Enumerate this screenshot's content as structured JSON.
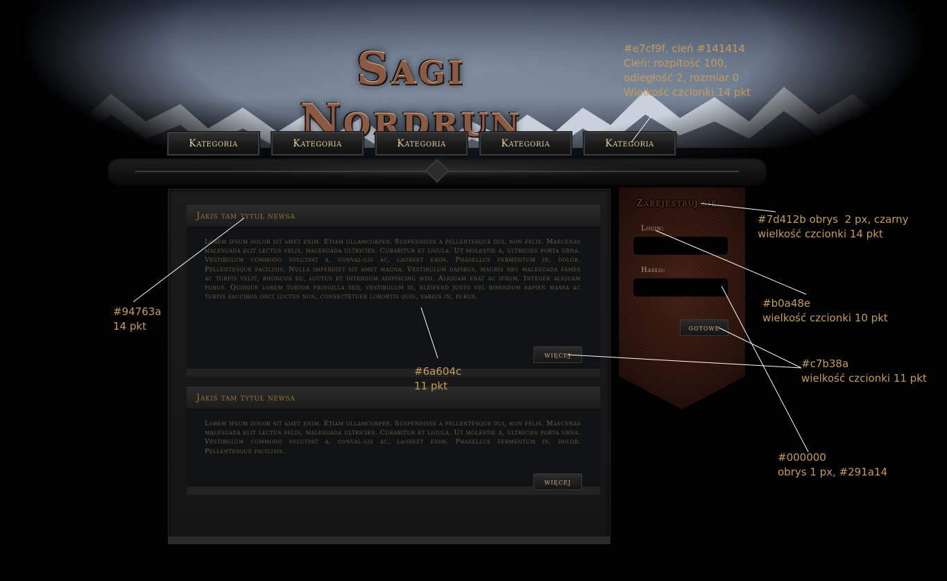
{
  "colors": {
    "nav_text": "#e7cf9f",
    "nav_shadow": "#141414",
    "news_title": "#94763a",
    "news_body": "#6a604c",
    "register_title": "#7d412b",
    "field_label": "#b0a48e",
    "button_text": "#c7b38a",
    "field_bg": "#000000",
    "field_border": "#291a14"
  },
  "header": {
    "logo": "Sagi Nordrun"
  },
  "nav": {
    "items": [
      "Kategoria",
      "Kategoria",
      "Kategoria",
      "Kategoria",
      "Kategoria"
    ]
  },
  "news": [
    {
      "title": "Jakiś tam tytuł newsa",
      "body": "Lorem ipsum dolor sit amet enim. Etiam ullamcorper. Suspendisse a pellentesque dui, non felis. Maecenas malesuada elit lectus felis, malesuada ultricies. Curabitur et ligula. Ut molestie a, ultricies porta urna. Vestibulum commodo volutpat a, conval-lis ac, laoreet enim. Phasellus fermentum in, dolor. Pellentesque facilisis. Nulla imperdiet sit amet magna. Vestibulum dapibus, mauris nec malesuada fames ac turpis velit, rhoncus eu, luctus et interdum adipiscing wisi. Aliquam erat ac ipsum. Integer aliquam purus. Quisque lorem tortor fringilla sed, vestibulum id, eleifend justo vel bibendum sapien massa ac turpis faucibus orci luctus non, consectetuer lobortis quis, varius in, purus.",
      "more": "więcej"
    },
    {
      "title": "Jakiś tam tytuł newsa",
      "body": "Lorem ipsum dolor sit amet enim. Etiam ullamcorper. Suspendisse a pellentesque dui, non felis. Maecenas malesuada elit lectus felis, malesuada ultricies. Curabitur et ligula. Ut molestie a, ultricies porta urna. Vestibulum commodo volutpat a, conval-lis ac, laoreet enim. Phasellus fermentum in, dolor. Pellentesque facilisis.",
      "more": "więcej"
    }
  ],
  "sidebar": {
    "title": "Zarejestruj się",
    "login_label": "Login:",
    "password_label": "Hasło:",
    "submit": "gotowe"
  },
  "annotations": {
    "nav": "#e7cf9f, cień #141414\nCień: rozpitość 100,\nodległość 2, rozmiar 0\nWielkość czcionki 14 pkt",
    "register": "#7d412b obrys  2 px, czarny\nwielkość czcionki 14 pkt",
    "labels": "#b0a48e\nwielkość czcionki 10 pkt",
    "buttons": "#c7b38a\nwielkość czcionki 11 pkt",
    "fields": "#000000\nobrys 1 px, #291a14",
    "news_title": "#94763a\n14 pkt",
    "news_body": "#6a604c\n11 pkt"
  }
}
